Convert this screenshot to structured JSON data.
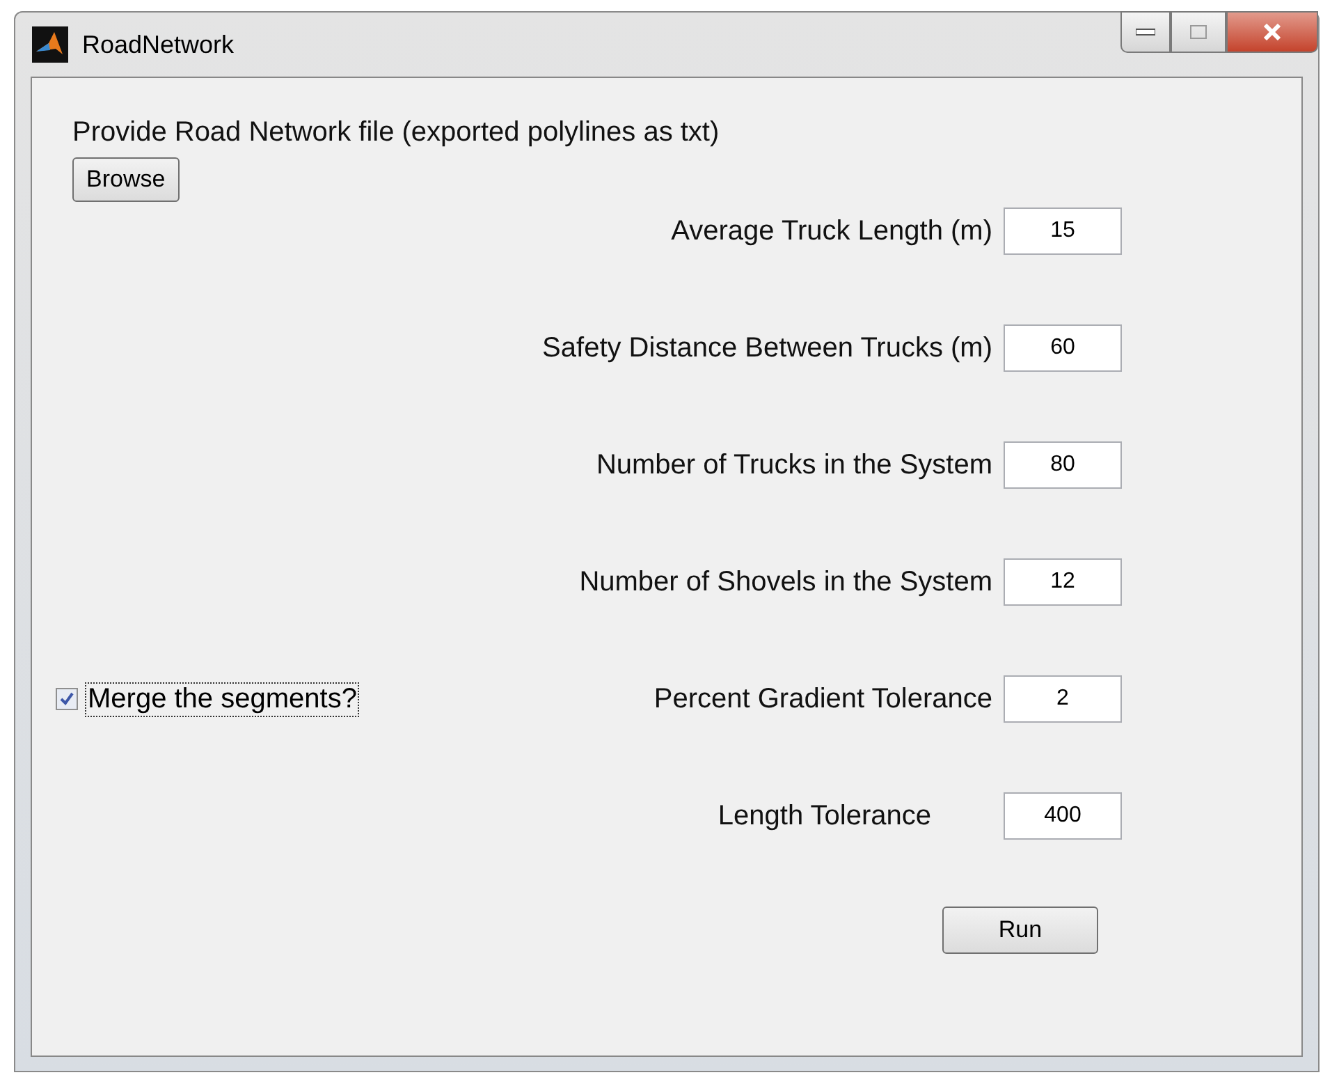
{
  "window": {
    "title": "RoadNetwork"
  },
  "file_prompt": "Provide Road Network file (exported polylines as txt)",
  "browse_button": "Browse",
  "merge_checkbox": {
    "label": "Merge the segments?",
    "checked": true
  },
  "parameters": [
    {
      "label": "Average Truck Length (m)",
      "value": "15"
    },
    {
      "label": "Safety Distance Between Trucks (m)",
      "value": "60"
    },
    {
      "label": "Number of Trucks in the System",
      "value": "80"
    },
    {
      "label": "Number of Shovels in the System",
      "value": "12"
    },
    {
      "label": "Percent Gradient Tolerance",
      "value": "2"
    },
    {
      "label": "Length Tolerance",
      "value": "400"
    }
  ],
  "run_button": "Run"
}
